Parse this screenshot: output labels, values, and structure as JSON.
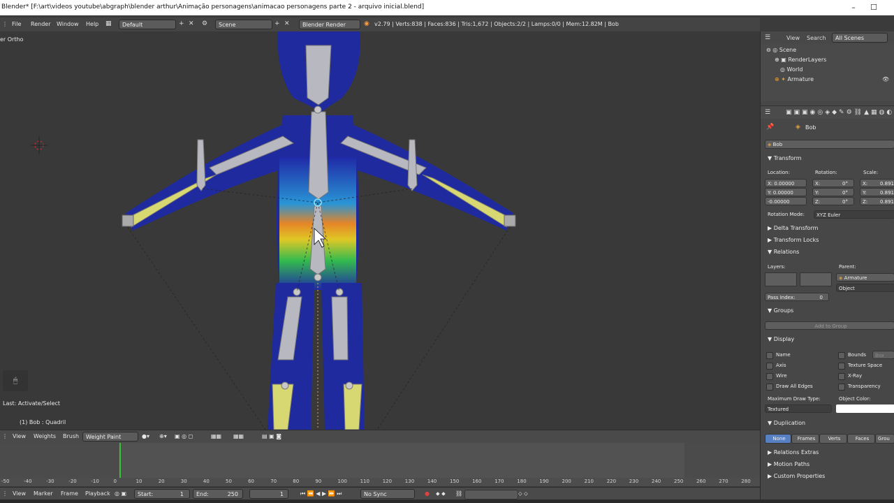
{
  "window": {
    "title": "Blender* [F:\\art\\videos youtube\\abgraph\\blender arthur\\Animação personagens\\animacao personagens parte 2 - arquivo inicial.blend]"
  },
  "info_bar": {
    "menus": [
      "File",
      "Render",
      "Window",
      "Help"
    ],
    "layout": "Default",
    "scene": "Scene",
    "engine": "Blender Render",
    "stats": "v2.79 | Verts:838 | Faces:836 | Tris:1,672 | Objects:2/2 | Lamps:0/0 | Mem:12.82M | Bob"
  },
  "viewport": {
    "view_label": "er Ortho",
    "last_op": "Last: Activate/Select",
    "object_label": "(1) Bob : Quadril"
  },
  "viewport_header": {
    "view": "View",
    "weights": "Weights",
    "brush": "Brush",
    "mode": "Weight Paint"
  },
  "timeline": {
    "ticks": [
      "-50",
      "-40",
      "-30",
      "-20",
      "-10",
      "0",
      "10",
      "20",
      "30",
      "40",
      "50",
      "60",
      "70",
      "80",
      "90",
      "100",
      "110",
      "120",
      "130",
      "140",
      "150",
      "160",
      "170",
      "180",
      "190",
      "200",
      "210",
      "220",
      "230",
      "240",
      "250",
      "260",
      "270",
      "280"
    ],
    "current_frame": 0,
    "footer": {
      "view": "View",
      "marker": "Marker",
      "frame": "Frame",
      "playback": "Playback",
      "start_label": "Start:",
      "start_value": "1",
      "end_label": "End:",
      "end_value": "250",
      "current": "1",
      "sync": "No Sync"
    }
  },
  "outliner": {
    "view": "View",
    "search": "Search",
    "filter": "All Scenes",
    "items": [
      "Scene",
      "RenderLayers",
      "World",
      "Armature"
    ]
  },
  "properties": {
    "breadcrumb": "Bob",
    "object_name": "Bob",
    "transform": {
      "title": "Transform",
      "location_label": "Location:",
      "rotation_label": "Rotation:",
      "scale_label": "Scale:",
      "loc": [
        "X: 0.00000",
        "Y: 0.00000",
        "-0.00000"
      ],
      "rot_x_label": "X:",
      "rot_y_label": "Y:",
      "rot_z_label": "Z:",
      "rot_value": "0°",
      "scale": [
        "X:",
        "Y:",
        "Z:"
      ],
      "scale_value": "0.891",
      "rotation_mode_label": "Rotation Mode:",
      "rotation_mode": "XYZ Euler"
    },
    "sections": {
      "delta": "Delta Transform",
      "locks": "Transform Locks",
      "relations": "Relations",
      "groups": "Groups",
      "display": "Display",
      "duplication": "Duplication",
      "relations_extras": "Relations Extras",
      "motion_paths": "Motion Paths",
      "custom_props": "Custom Properties"
    },
    "relations": {
      "layers_label": "Layers:",
      "parent_label": "Parent:",
      "parent": "Armature",
      "parent_type": "Object",
      "pass_index_label": "Pass Index:",
      "pass_index": "0"
    },
    "groups_btn": "Add to Group",
    "display": {
      "name": "Name",
      "axis": "Axis",
      "wire": "Wire",
      "draw_all_edges": "Draw All Edges",
      "bounds": "Bounds",
      "bounds_type": "Box",
      "texture_space": "Texture Space",
      "xray": "X-Ray",
      "transparency": "Transparency",
      "max_draw_label": "Maximum Draw Type:",
      "max_draw": "Textured",
      "object_color_label": "Object Color:"
    },
    "duplication_tabs": [
      "None",
      "Frames",
      "Verts",
      "Faces",
      "Grou"
    ]
  },
  "colors": {
    "accent_blue": "#5680c2",
    "bone_yellow": "#d8d872",
    "timeline_green": "#38c238"
  }
}
